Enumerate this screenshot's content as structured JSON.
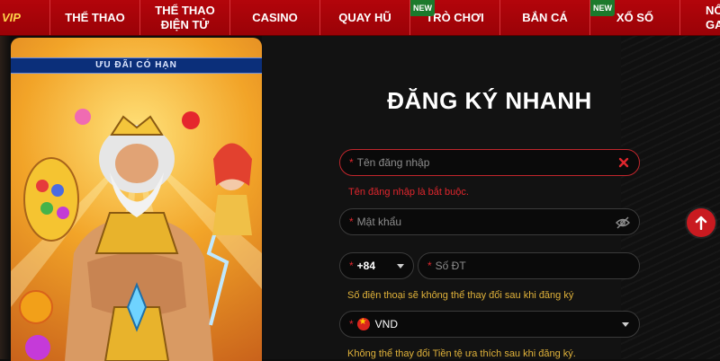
{
  "nav": {
    "logo": "VIP",
    "items": [
      {
        "label": "THỂ THAO",
        "badge": ""
      },
      {
        "label": "THỂ THAO ĐIỆN TỬ",
        "badge": ""
      },
      {
        "label": "CASINO",
        "badge": ""
      },
      {
        "label": "QUAY HŨ",
        "badge": ""
      },
      {
        "label": "TRÒ CHƠI",
        "badge": "NEW"
      },
      {
        "label": "BẮN CÁ",
        "badge": ""
      },
      {
        "label": "XỔ SỐ",
        "badge": "NEW"
      },
      {
        "label": "NỔ GA",
        "badge": ""
      }
    ]
  },
  "promo": {
    "header": "ƯU ĐÃI CÓ HẠN"
  },
  "form": {
    "title": "ĐĂNG KÝ NHANH",
    "username": {
      "required": "*",
      "placeholder": "Tên đăng nhập",
      "error": "Tên đăng nhập là bắt buộc."
    },
    "password": {
      "required": "*",
      "placeholder": "Mật khẩu"
    },
    "phone": {
      "country_code": "+84",
      "required": "*",
      "placeholder": "Số ĐT",
      "hint": "Số điện thoại sẽ không thể thay đổi sau khi đăng ký"
    },
    "currency": {
      "required": "*",
      "value": "VND",
      "hint": "Không thể thay đổi Tiền tệ ưa thích sau khi đăng ký."
    }
  },
  "colors": {
    "brand_red": "#b3050b",
    "error_red": "#e0262d",
    "hint_gold": "#e0b23a"
  },
  "icons": [
    "clear-icon",
    "eye-off-icon",
    "chevron-down-icon",
    "arrow-up-icon",
    "vietnam-flag-icon"
  ]
}
